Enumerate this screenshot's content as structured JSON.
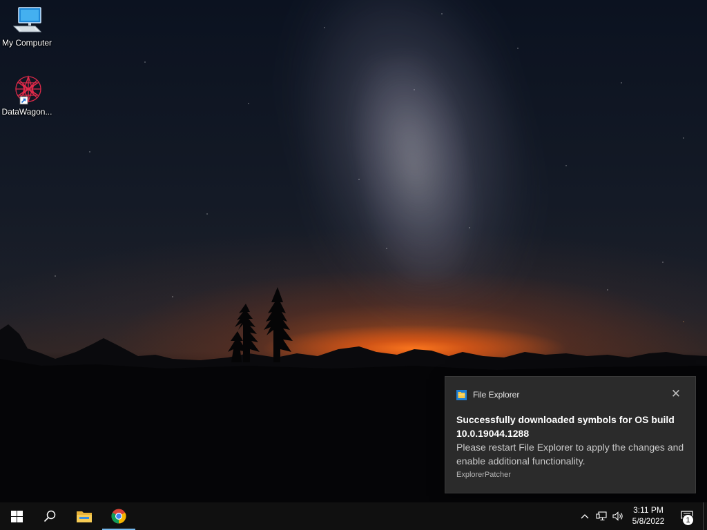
{
  "desktop": {
    "icons": [
      {
        "label": "My Computer",
        "icon": "computer-icon"
      },
      {
        "label": "DataWagon...",
        "icon": "datawagon-shortcut-icon"
      }
    ]
  },
  "notification": {
    "app_name": "File Explorer",
    "app_icon": "file-explorer-icon",
    "title": "Successfully downloaded symbols for OS build 10.0.19044.1288",
    "body": "Please restart File Explorer to apply the changes and enable additional functionality.",
    "attribution": "ExplorerPatcher",
    "close_icon": "close-icon"
  },
  "taskbar": {
    "start_icon": "windows-start-icon",
    "search_icon": "search-icon",
    "pinned": [
      {
        "name": "File Explorer",
        "icon": "folder-icon",
        "active": false
      },
      {
        "name": "Google Chrome",
        "icon": "chrome-icon",
        "active": true
      }
    ],
    "tray": {
      "overflow_icon": "chevron-up-icon",
      "network_icon": "network-icon",
      "volume_icon": "volume-icon",
      "time": "3:11 PM",
      "date": "5/8/2022",
      "action_center_icon": "action-center-icon",
      "notification_count": "1"
    }
  },
  "colors": {
    "accent": "#76b9ed",
    "taskbar_bg": "#101010",
    "toast_bg": "#2b2b2b"
  }
}
